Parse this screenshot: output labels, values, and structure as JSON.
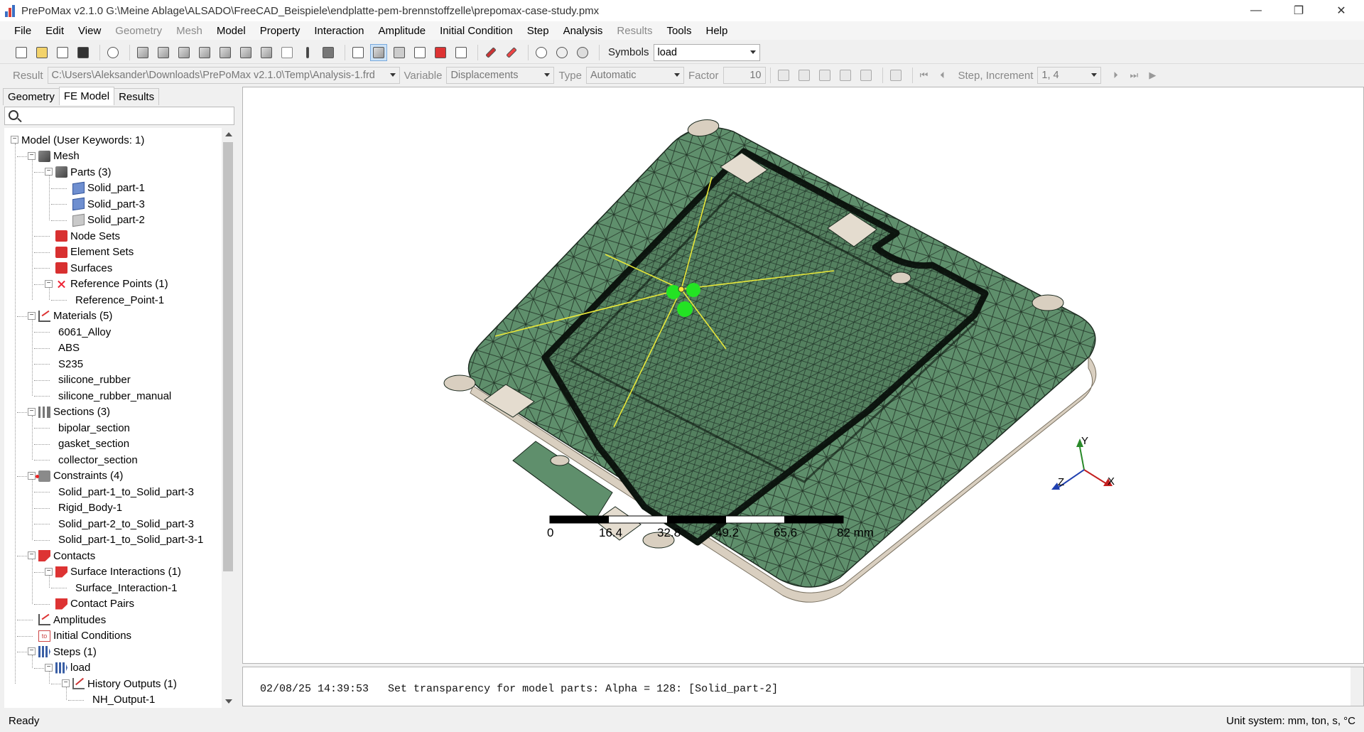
{
  "titlebar": {
    "title": "PrePoMax v2.1.0   G:\\Meine Ablage\\ALSADO\\FreeCAD_Beispiele\\endplatte-pem-brennstoffzelle\\prepomax-case-study.pmx",
    "minimize": "—",
    "restore": "❐",
    "close": "✕"
  },
  "menu": [
    "File",
    "Edit",
    "View",
    "Geometry",
    "Mesh",
    "Model",
    "Property",
    "Interaction",
    "Amplitude",
    "Initial Condition",
    "Step",
    "Analysis",
    "Results",
    "Tools",
    "Help"
  ],
  "menu_disabled": [
    "Geometry",
    "Mesh",
    "Results"
  ],
  "toolbar1": {
    "symbols_label": "Symbols",
    "symbols_value": "load"
  },
  "toolbar2": {
    "result_label": "Result",
    "result_value": "C:\\Users\\Aleksander\\Downloads\\PrePoMax v2.1.0\\Temp\\Analysis-1.frd",
    "variable_label": "Variable",
    "variable_value": "Displacements",
    "type_label": "Type",
    "type_value": "Automatic",
    "factor_label": "Factor",
    "factor_value": "10",
    "step_label": "Step, Increment",
    "step_value": "1, 4"
  },
  "left_tabs": [
    "Geometry",
    "FE Model",
    "Results"
  ],
  "tree": [
    {
      "label": "Model (User Keywords: 1)",
      "level": 0,
      "icon": "none",
      "exp": "−"
    },
    {
      "label": "Mesh",
      "level": 1,
      "icon": "mesh",
      "exp": "−"
    },
    {
      "label": "Parts (3)",
      "level": 2,
      "icon": "mesh",
      "exp": "−"
    },
    {
      "label": "Solid_part-1",
      "level": 3,
      "icon": "part",
      "exp": ""
    },
    {
      "label": "Solid_part-3",
      "level": 3,
      "icon": "part",
      "exp": ""
    },
    {
      "label": "Solid_part-2",
      "level": 3,
      "icon": "part2",
      "exp": ""
    },
    {
      "label": "Node Sets",
      "level": 2,
      "icon": "red",
      "exp": ""
    },
    {
      "label": "Element Sets",
      "level": 2,
      "icon": "red",
      "exp": ""
    },
    {
      "label": "Surfaces",
      "level": 2,
      "icon": "red",
      "exp": ""
    },
    {
      "label": "Reference Points (1)",
      "level": 2,
      "icon": "ref",
      "exp": "−"
    },
    {
      "label": "Reference_Point-1",
      "level": 3,
      "icon": "none",
      "exp": ""
    },
    {
      "label": "Materials (5)",
      "level": 1,
      "icon": "graph",
      "exp": "−"
    },
    {
      "label": "6061_Alloy",
      "level": 2,
      "icon": "none",
      "exp": ""
    },
    {
      "label": "ABS",
      "level": 2,
      "icon": "none",
      "exp": ""
    },
    {
      "label": "S235",
      "level": 2,
      "icon": "none",
      "exp": ""
    },
    {
      "label": "silicone_rubber",
      "level": 2,
      "icon": "none",
      "exp": ""
    },
    {
      "label": "silicone_rubber_manual",
      "level": 2,
      "icon": "none",
      "exp": ""
    },
    {
      "label": "Sections (3)",
      "level": 1,
      "icon": "sect",
      "exp": "−"
    },
    {
      "label": "bipolar_section",
      "level": 2,
      "icon": "none",
      "exp": ""
    },
    {
      "label": "gasket_section",
      "level": 2,
      "icon": "none",
      "exp": ""
    },
    {
      "label": "collector_section",
      "level": 2,
      "icon": "none",
      "exp": ""
    },
    {
      "label": "Constraints (4)",
      "level": 1,
      "icon": "constr",
      "exp": "−"
    },
    {
      "label": "Solid_part-1_to_Solid_part-3",
      "level": 2,
      "icon": "none",
      "exp": ""
    },
    {
      "label": "Rigid_Body-1",
      "level": 2,
      "icon": "none",
      "exp": ""
    },
    {
      "label": "Solid_part-2_to_Solid_part-3",
      "level": 2,
      "icon": "none",
      "exp": ""
    },
    {
      "label": "Solid_part-1_to_Solid_part-3-1",
      "level": 2,
      "icon": "none",
      "exp": ""
    },
    {
      "label": "Contacts",
      "level": 1,
      "icon": "contact",
      "exp": "−"
    },
    {
      "label": "Surface Interactions (1)",
      "level": 2,
      "icon": "contact",
      "exp": "−"
    },
    {
      "label": "Surface_Interaction-1",
      "level": 3,
      "icon": "none",
      "exp": ""
    },
    {
      "label": "Contact Pairs",
      "level": 2,
      "icon": "contact",
      "exp": ""
    },
    {
      "label": "Amplitudes",
      "level": 1,
      "icon": "graph",
      "exp": ""
    },
    {
      "label": "Initial Conditions",
      "level": 1,
      "icon": "init",
      "exp": ""
    },
    {
      "label": "Steps (1)",
      "level": 1,
      "icon": "step",
      "exp": "−"
    },
    {
      "label": "load",
      "level": 2,
      "icon": "step",
      "exp": "−"
    },
    {
      "label": "History Outputs (1)",
      "level": 3,
      "icon": "hist",
      "exp": "−"
    },
    {
      "label": "NH_Output-1",
      "level": 4,
      "icon": "none",
      "exp": ""
    }
  ],
  "viewport": {
    "scale_labels": [
      "0",
      "16.4",
      "32.8",
      "49.2",
      "65.6",
      "82 mm"
    ],
    "axes": {
      "x": "X",
      "y": "Y",
      "z": "Z"
    }
  },
  "console": {
    "line": "02/08/25 14:39:53   Set transparency for model parts: Alpha = 128: [Solid_part-2]"
  },
  "status": {
    "left": "Ready",
    "right": "Unit system: mm, ton, s, °C"
  },
  "colors": {
    "mesh_fill": "#5f8f6c",
    "mesh_line": "#1b2a1f",
    "load_lines": "#e8e83a",
    "rp_green": "#23e323",
    "plate_beige": "#d9cfc0"
  }
}
